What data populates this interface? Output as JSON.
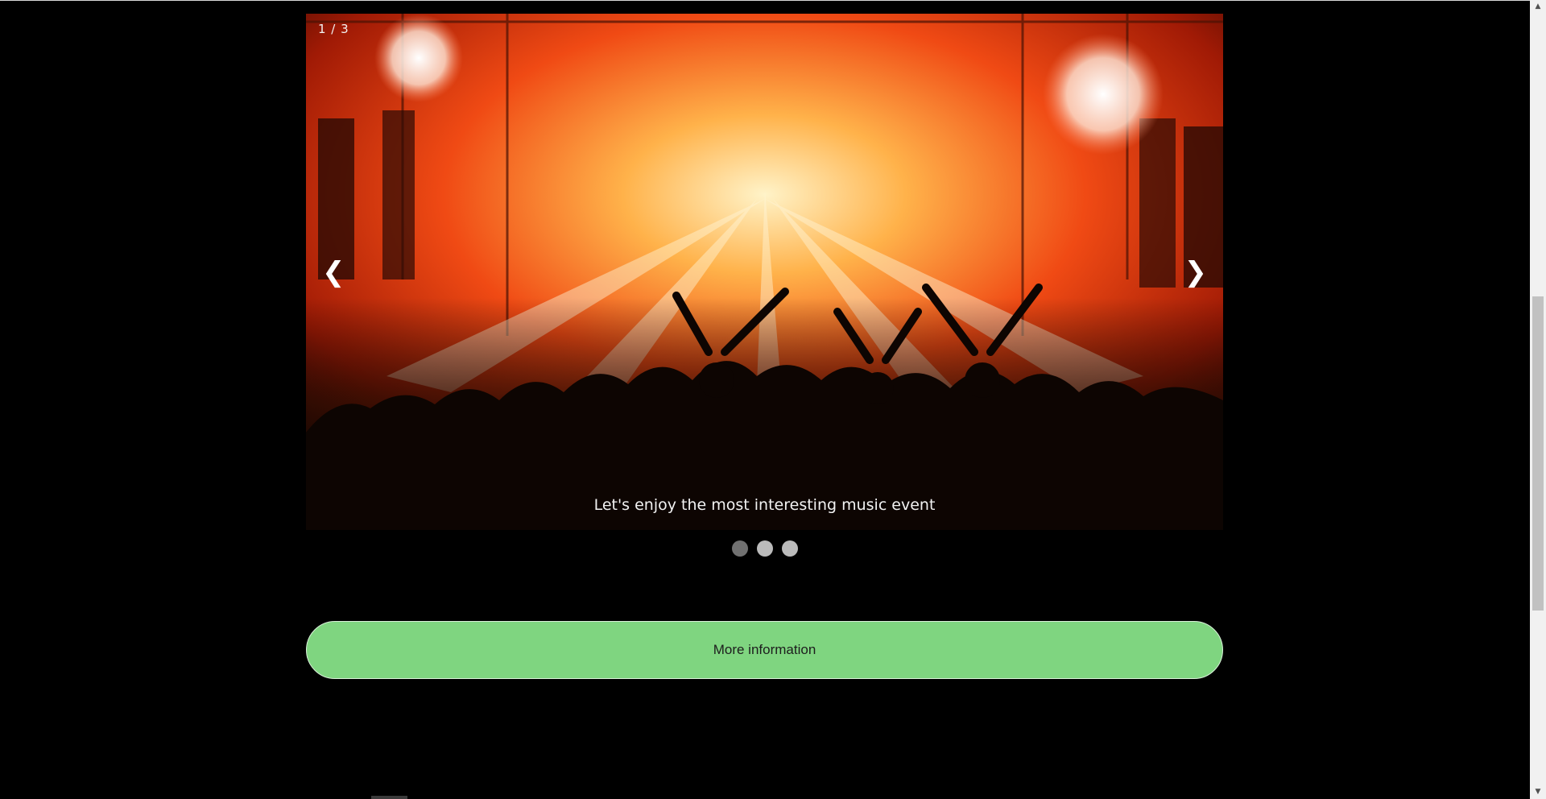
{
  "slideshow": {
    "counter": "1 / 3",
    "prev_arrow": "❮",
    "next_arrow": "❯",
    "caption": "Let's enjoy the most interesting music event",
    "image_icon": "concert-stage-fireworks-image",
    "dots": [
      {
        "active": true
      },
      {
        "active": false
      },
      {
        "active": false
      }
    ]
  },
  "button": {
    "label": "More information",
    "color": "#7fd580"
  },
  "scrollbar": {
    "up_icon": "▲",
    "down_icon": "▼"
  },
  "colors": {
    "background": "#000000",
    "dot_active": "#717171",
    "dot_inactive": "#bbbbbb",
    "caption_text": "#f2f2f2"
  }
}
